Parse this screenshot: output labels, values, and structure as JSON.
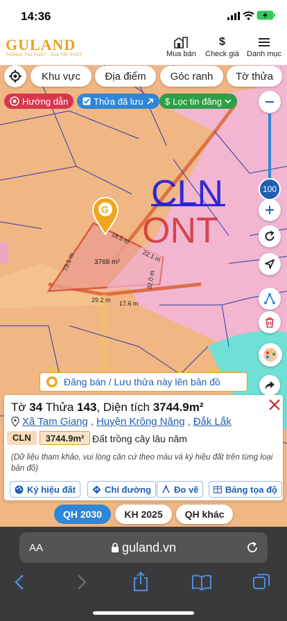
{
  "status": {
    "time": "14:36"
  },
  "header": {
    "logo": "GULAND",
    "tagline": "THÔNG TIN THẬT · GIÁ TRỊ THẬT",
    "buttons": [
      "Mua bán",
      "Check giá",
      "Danh mục"
    ]
  },
  "map": {
    "filters": [
      "Khu vực",
      "Địa điểm",
      "Góc ranh",
      "Tờ thửa"
    ],
    "pills": [
      {
        "label": "Hướng dẫn",
        "color": "#d9364c"
      },
      {
        "label": "Thửa đã lưu",
        "color": "#2f86d6"
      },
      {
        "label": "Lọc tin đăng",
        "color": "#2e9f46"
      }
    ],
    "zoom": "100",
    "zone_labels": [
      "CLN",
      "ONT"
    ],
    "parcel": {
      "area": "3768 m²",
      "edges": [
        "18.5 m",
        "22.1 m",
        "73.1 m",
        "32.0 m",
        "29.2 m",
        "17.6 m"
      ]
    },
    "post_banner": "Đăng bán / Lưu thửa này lên bản đồ"
  },
  "card": {
    "sheet_label": "Tờ",
    "sheet": "34",
    "plot_label": "Thửa",
    "plot": "143",
    "area_label": "Diện tích",
    "area": "3744.9m²",
    "commune": "Xã Tam Giang",
    "district": "Huyện Krông Năng",
    "province": "Đắk Lắk",
    "land_code": "CLN",
    "land_area": "3744.9m²",
    "land_type": "Đất trồng cây lâu năm",
    "note": "(Dữ liệu tham khảo, vui lòng căn cứ theo màu và ký hiệu đất trên từng loại bản đồ)",
    "tools": [
      "Ký hiệu đất",
      "Chỉ đường",
      "Đo vẽ",
      "Bảng tọa độ"
    ]
  },
  "plan_tabs": [
    "QH 2030",
    "KH 2025",
    "QH khác"
  ],
  "browser": {
    "aa": "AA",
    "url": "guland.vn"
  },
  "colors": {
    "brand": "#e8a020",
    "link": "#1f5fb5",
    "active_tab": "#2f86d6"
  }
}
